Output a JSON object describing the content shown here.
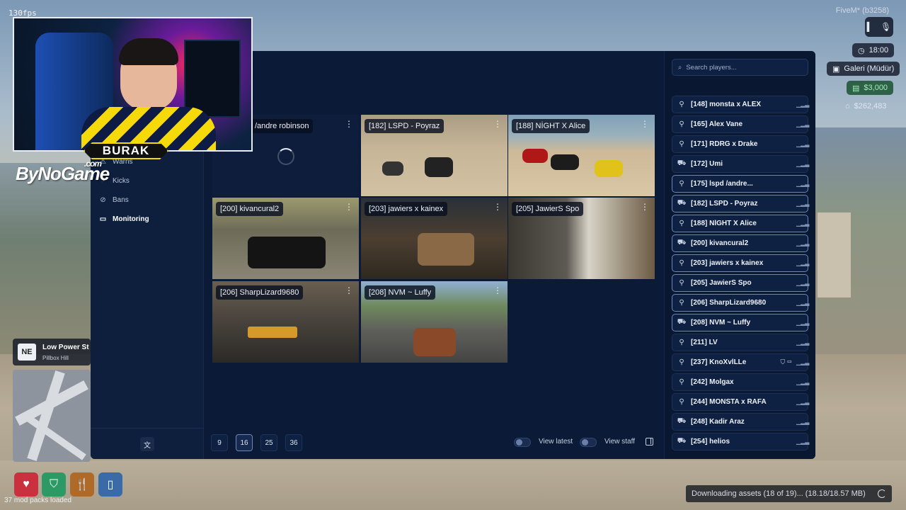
{
  "overlay": {
    "fps": "130fps",
    "fivem_build": "FiveM* (b3258)",
    "streamer_name": "BURAK",
    "watermark": "ByNoGame",
    "watermark_suffix": ".com"
  },
  "hud": {
    "time": "18:00",
    "job": "Galeri (Müdür)",
    "cash": "$3,000",
    "bank": "$262,483"
  },
  "sidebar": {
    "items": [
      {
        "label": "Warns",
        "icon": "warning-icon"
      },
      {
        "label": "Kicks",
        "icon": "kick-icon"
      },
      {
        "label": "Bans",
        "icon": "ban-icon"
      },
      {
        "label": "Monitoring",
        "icon": "monitor-icon",
        "active": true
      }
    ],
    "lang_icon": "translate-icon"
  },
  "monitor": {
    "tiles": [
      {
        "label": "/andre robinson",
        "loading": true
      },
      {
        "label": "[182] LSPD - Poyraz"
      },
      {
        "label": "[188] NİGHT X Alice"
      },
      {
        "label": "[200] kivancural2"
      },
      {
        "label": "[203] jawiers x kainex"
      },
      {
        "label": "[205] JawierS Spo"
      },
      {
        "label": "[206] SharpLizard9680"
      },
      {
        "label": "[208] NVM ~ Luffy"
      }
    ],
    "page_sizes": [
      "9",
      "16",
      "25",
      "36"
    ],
    "selected_page_size": "16",
    "toggle_latest": "View latest",
    "toggle_staff": "View staff"
  },
  "players": {
    "search_placeholder": "Search players...",
    "list": [
      {
        "name": "[148] monsta x ALEX",
        "icon": "walk-icon"
      },
      {
        "name": "[165] Alex Vane",
        "icon": "walk-icon"
      },
      {
        "name": "[171] RDRG x Drake",
        "icon": "walk-icon"
      },
      {
        "name": "[172] Umi",
        "icon": "car-icon"
      },
      {
        "name": "[175]          lspd /andre...",
        "icon": "walk-icon",
        "highlighted": true
      },
      {
        "name": "[182] LSPD - Poyraz",
        "icon": "car-icon",
        "highlighted": true
      },
      {
        "name": "[188] NİGHT X Alice",
        "icon": "walk-icon",
        "highlighted": true
      },
      {
        "name": "[200] kivancural2",
        "icon": "car-icon",
        "highlighted": true
      },
      {
        "name": "[203] jawiers x kainex",
        "icon": "walk-icon",
        "highlighted": true
      },
      {
        "name": "[205] JawierS Spo",
        "icon": "walk-icon",
        "highlighted": true
      },
      {
        "name": "[206] SharpLizard9680",
        "icon": "walk-icon",
        "highlighted": true
      },
      {
        "name": "[208] NVM ~ Luffy",
        "icon": "car-icon",
        "highlighted": true
      },
      {
        "name": "[211] LV",
        "icon": "walk-icon"
      },
      {
        "name": "[237] KnoXvlLLe",
        "icon": "walk-icon",
        "extra": "⛉ ▭"
      },
      {
        "name": "[242] Molgax",
        "icon": "walk-icon"
      },
      {
        "name": "[244] MONSTA x RAFA",
        "icon": "walk-icon"
      },
      {
        "name": "[248] Kadir Araz",
        "icon": "car-icon"
      },
      {
        "name": "[254] helios",
        "icon": "car-icon"
      }
    ]
  },
  "location": {
    "direction": "NE",
    "street": "Low Power St",
    "area": "Pillbox Hill"
  },
  "footer": {
    "mod_packs": "37 mod packs loaded",
    "download_status": "Downloading assets (18 of 19)... (18.18/18.57 MB)"
  }
}
